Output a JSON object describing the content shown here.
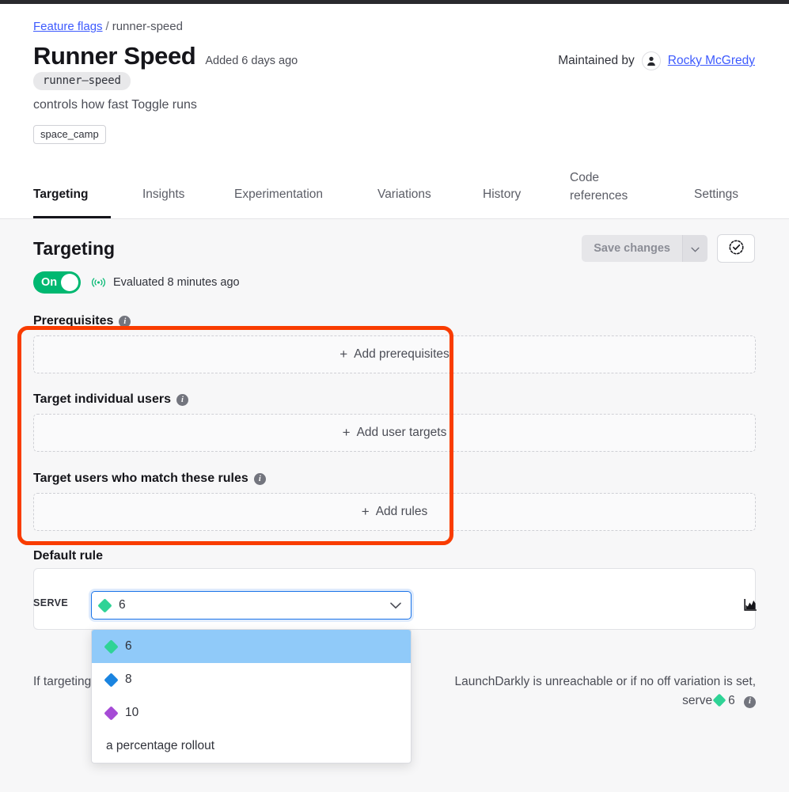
{
  "breadcrumb": {
    "root": "Feature flags",
    "separator": "/",
    "current": "runner-speed"
  },
  "header": {
    "title": "Runner Speed",
    "added": "Added 6 days ago",
    "key": "runner–speed",
    "description": "controls how fast Toggle runs",
    "tag": "space_camp",
    "maintained_by_label": "Maintained by",
    "maintainer_name": "Rocky McGredy",
    "avatar_icon": "user-icon"
  },
  "tabs": [
    {
      "label": "Targeting",
      "active": true
    },
    {
      "label": "Insights",
      "active": false
    },
    {
      "label": "Experimentation",
      "active": false
    },
    {
      "label": "Variations",
      "active": false
    },
    {
      "label": "History",
      "active": false
    },
    {
      "label": "Code references",
      "label_line1": "Code",
      "label_line2": "references",
      "active": false
    },
    {
      "label": "Settings",
      "active": false
    }
  ],
  "targeting": {
    "heading": "Targeting",
    "save_label": "Save changes",
    "save_caret_icon": "chevron-down-icon",
    "approval_icon": "dashed-circle-check-icon",
    "toggle_state_label": "On",
    "broadcast_icon": "broadcast-icon",
    "evaluated_text": "Evaluated 8 minutes ago"
  },
  "sections": [
    {
      "label": "Prerequisites",
      "info_icon": "info-icon",
      "add_label": "Add prerequisites",
      "plus": "+"
    },
    {
      "label": "Target individual users",
      "info_icon": "info-icon",
      "add_label": "Add user targets",
      "plus": "+"
    },
    {
      "label": "Target users who match these rules",
      "info_icon": "info-icon",
      "add_label": "Add rules",
      "plus": "+"
    }
  ],
  "default_rule": {
    "label": "Default rule",
    "serve_label": "SERVE",
    "selected_value": "6",
    "selected_color": "#2fd396",
    "caret_icon": "chevron-down-icon",
    "chart_icon": "bar-chart-icon",
    "options": [
      {
        "label": "6",
        "color": "#2fd396",
        "selected": true
      },
      {
        "label": "8",
        "color": "#1a84e0",
        "selected": false
      },
      {
        "label": "10",
        "color": "#a64bd6",
        "selected": false
      },
      {
        "label": "a percentage rollout",
        "color": null,
        "selected": false
      }
    ]
  },
  "fallthrough": {
    "lead": "If targeting is off, or",
    "text": "LaunchDarkly is unreachable or if no off variation is set,",
    "serve_word": "serve",
    "serve_value": "6",
    "serve_color": "#2fd396",
    "info_icon": "info-icon"
  },
  "highlight_color": "#f93c00"
}
